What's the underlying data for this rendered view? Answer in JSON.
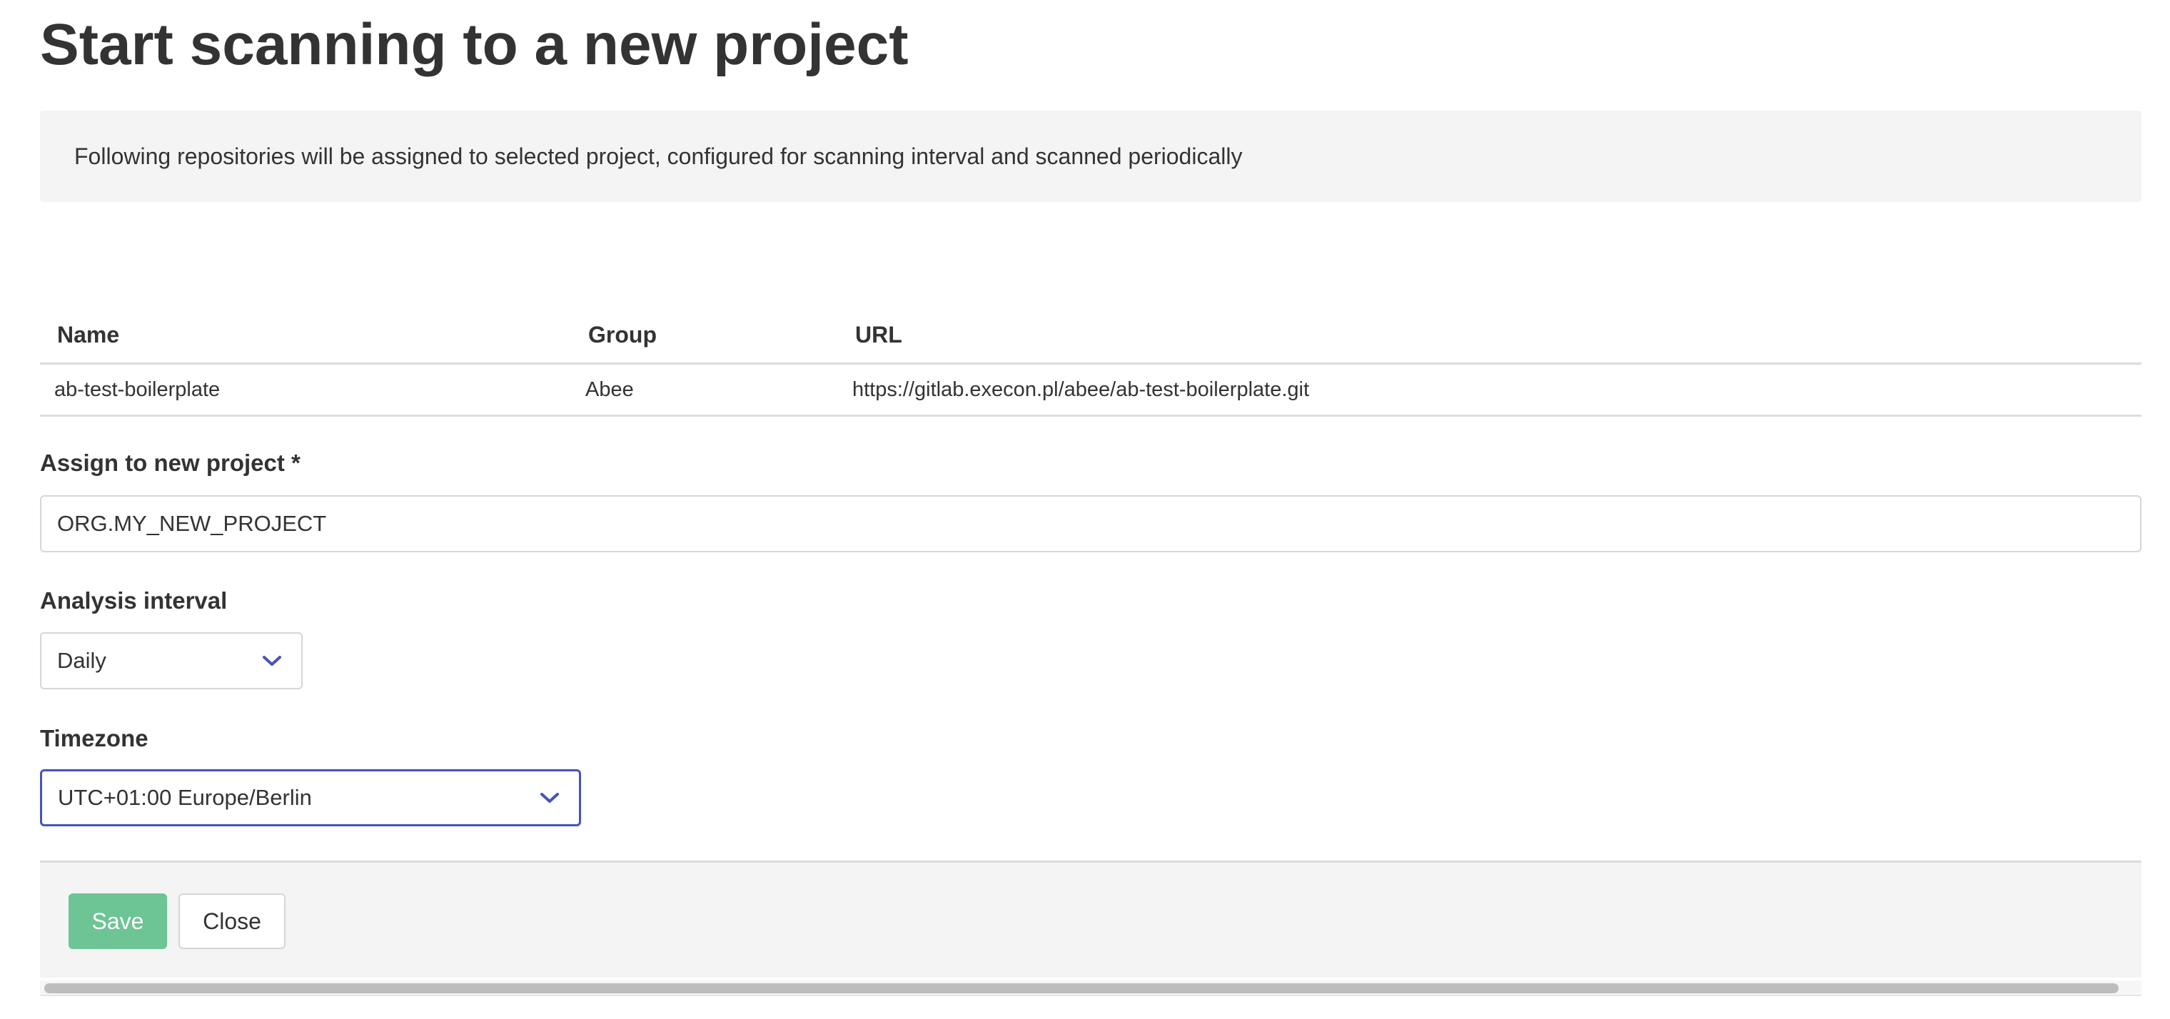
{
  "page": {
    "title": "Start scanning to a new project"
  },
  "info": {
    "message": "Following repositories will be assigned to selected project, configured for scanning interval and scanned periodically"
  },
  "table": {
    "headers": {
      "name": "Name",
      "group": "Group",
      "url": "URL"
    },
    "rows": [
      {
        "name": "ab-test-boilerplate",
        "group": "Abee",
        "url": "https://gitlab.execon.pl/abee/ab-test-boilerplate.git"
      }
    ]
  },
  "form": {
    "project": {
      "label": "Assign to new project *",
      "value": "ORG.MY_NEW_PROJECT"
    },
    "interval": {
      "label": "Analysis interval",
      "value": "Daily"
    },
    "timezone": {
      "label": "Timezone",
      "value": "UTC+01:00 Europe/Berlin"
    }
  },
  "footer": {
    "save_label": "Save",
    "close_label": "Close"
  },
  "colors": {
    "accent": "#4654b8",
    "save_button": "#6dc494",
    "panel_background": "#f4f4f4"
  },
  "icons": {
    "select_chevron": "chevron-down-icon"
  }
}
